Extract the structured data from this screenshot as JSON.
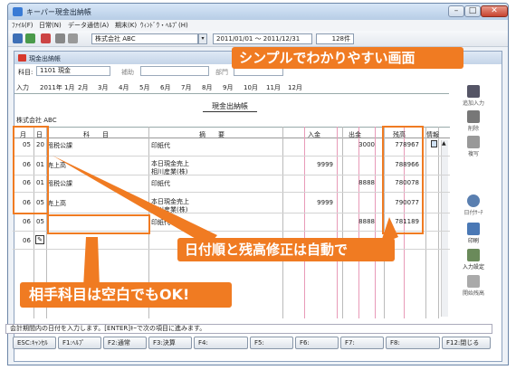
{
  "window": {
    "title": "キーパー現金出納帳",
    "min": "–",
    "max": "□",
    "close": "✕"
  },
  "menu": [
    "ﾌｧｲﾙ(F)",
    "日常(N)",
    "データ通信(A)",
    "期末(K)",
    "ｳｨﾝﾄﾞｳ・ﾍﾙﾌﾟ(H)"
  ],
  "toolbar": {
    "company": "株式会社 ABC",
    "period": "2011/01/01 ～ 2011/12/31",
    "count": "128件"
  },
  "inner": {
    "title": "現金出納帳"
  },
  "form": {
    "subject_label": "科目:",
    "subject_value": "1101 現金",
    "aux_label": "補助",
    "dept_label": "部門"
  },
  "tabs": [
    "入力",
    "2011年 1月",
    "2月",
    "3月",
    "4月",
    "5月",
    "6月",
    "7月",
    "8月",
    "9月",
    "10月",
    "11月",
    "12月"
  ],
  "ledger": {
    "title": "現金出納帳",
    "company": "株式会社 ABC",
    "headers": {
      "month": "月",
      "day": "日",
      "account": "科　　目",
      "memo": "摘　　要",
      "in": "入金",
      "out": "出金",
      "balance": "残高",
      "info": "情報"
    },
    "rows": [
      {
        "m": "05",
        "d": "20",
        "account": "租税公課",
        "memo": "印紙代",
        "memo2": "",
        "in": "",
        "out": "3000",
        "bal": "778967"
      },
      {
        "m": "06",
        "d": "01",
        "account": "売上高",
        "memo": "本日現金売上",
        "memo2": "相川産業(株)",
        "in": "9999",
        "out": "",
        "bal": "788966"
      },
      {
        "m": "06",
        "d": "01",
        "account": "租税公課",
        "memo": "印紙代",
        "memo2": "",
        "in": "",
        "out": "8888",
        "bal": "780078"
      },
      {
        "m": "06",
        "d": "05",
        "account": "売上高",
        "memo": "本日現金売上",
        "memo2": "相川産業(株)",
        "in": "9999",
        "out": "",
        "bal": "790077"
      },
      {
        "m": "06",
        "d": "05",
        "account": "",
        "memo": "印紙代",
        "memo2": "",
        "in": "",
        "out": "8888",
        "bal": "781189"
      },
      {
        "m": "06",
        "d": "",
        "account": "",
        "memo": "",
        "memo2": "",
        "in": "",
        "out": "",
        "bal": ""
      }
    ]
  },
  "side": [
    {
      "label": "追加入力"
    },
    {
      "label": "削除"
    },
    {
      "label": "複写"
    },
    {
      "label": "日付ｻｰﾁ"
    },
    {
      "label": "印刷"
    },
    {
      "label": "入力設定"
    },
    {
      "label": "開始残高"
    }
  ],
  "status": "会計期間内の日付を入力します。[ENTER]ｷｰで次の項目に進みます。",
  "fkeys": [
    "ESC:ｷｬﾝｾﾙ",
    "F1:ﾍﾙﾌﾟ",
    "F2:通常",
    "F3:決算",
    "F4:",
    "F5:",
    "F6:",
    "F7:",
    "F8:",
    "F12:閉じる"
  ],
  "callouts": {
    "top": "シンプルでわかりやすい画面",
    "middle": "日付順と残高修正は自動で",
    "bottom": "相手科目は空白でもOK!"
  },
  "colors": {
    "accent": "#f07b22",
    "title_bar": "#c4d4e8"
  }
}
